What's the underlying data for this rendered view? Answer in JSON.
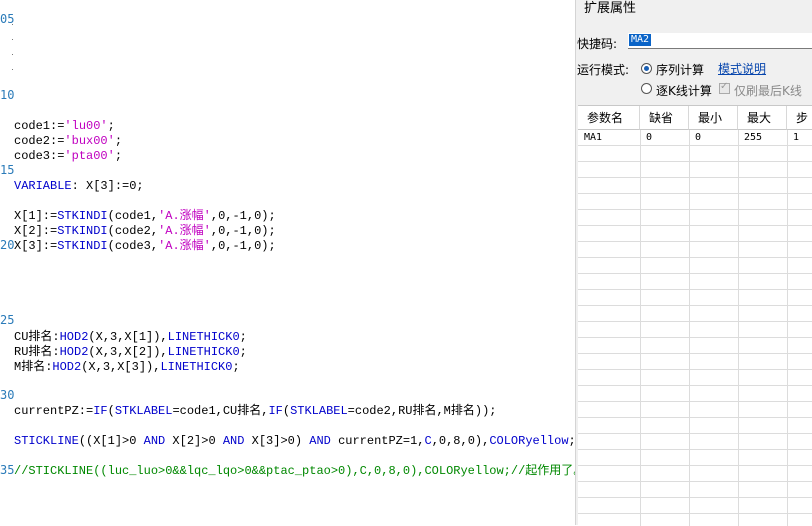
{
  "editor": {
    "line_numbers": [
      "05",
      "10",
      "15",
      "20",
      "25",
      "30",
      "35"
    ],
    "lines": {
      "code1": [
        {
          "t": "code1:=",
          "c": ""
        },
        {
          "t": "'lu00'",
          "c": "st"
        },
        {
          "t": ";",
          "c": ""
        }
      ],
      "code2": [
        {
          "t": "code2:=",
          "c": ""
        },
        {
          "t": "'bux00'",
          "c": "st"
        },
        {
          "t": ";",
          "c": ""
        }
      ],
      "code3": [
        {
          "t": "code3:=",
          "c": ""
        },
        {
          "t": "'pta00'",
          "c": "st"
        },
        {
          "t": ";",
          "c": ""
        }
      ],
      "variable": [
        {
          "t": "VARIABLE",
          "c": "kw"
        },
        {
          "t": ": X[3]:=0;",
          "c": ""
        }
      ],
      "x1": [
        {
          "t": "X[1]:=",
          "c": ""
        },
        {
          "t": "STKINDI",
          "c": "fn"
        },
        {
          "t": "(code1,",
          "c": ""
        },
        {
          "t": "'A.涨幅'",
          "c": "st"
        },
        {
          "t": ",0,-1,0);",
          "c": ""
        }
      ],
      "x2": [
        {
          "t": "X[2]:=",
          "c": ""
        },
        {
          "t": "STKINDI",
          "c": "fn"
        },
        {
          "t": "(code2,",
          "c": ""
        },
        {
          "t": "'A.涨幅'",
          "c": "st"
        },
        {
          "t": ",0,-1,0);",
          "c": ""
        }
      ],
      "x3": [
        {
          "t": "X[3]:=",
          "c": ""
        },
        {
          "t": "STKINDI",
          "c": "fn"
        },
        {
          "t": "(code3,",
          "c": ""
        },
        {
          "t": "'A.涨幅'",
          "c": "st"
        },
        {
          "t": ",0,-1,0);",
          "c": ""
        }
      ],
      "cu": [
        {
          "t": "CU排名:",
          "c": ""
        },
        {
          "t": "HOD2",
          "c": "fn"
        },
        {
          "t": "(X,3,X[1]),",
          "c": ""
        },
        {
          "t": "LINETHICK0",
          "c": "fn"
        },
        {
          "t": ";",
          "c": ""
        }
      ],
      "ru": [
        {
          "t": "RU排名:",
          "c": ""
        },
        {
          "t": "HOD2",
          "c": "fn"
        },
        {
          "t": "(X,3,X[2]),",
          "c": ""
        },
        {
          "t": "LINETHICK0",
          "c": "fn"
        },
        {
          "t": ";",
          "c": ""
        }
      ],
      "m": [
        {
          "t": "M排名:",
          "c": ""
        },
        {
          "t": "HOD2",
          "c": "fn"
        },
        {
          "t": "(X,3,X[3]),",
          "c": ""
        },
        {
          "t": "LINETHICK0",
          "c": "fn"
        },
        {
          "t": ";",
          "c": ""
        }
      ],
      "pz": [
        {
          "t": "currentPZ:=",
          "c": ""
        },
        {
          "t": "IF",
          "c": "fn"
        },
        {
          "t": "(",
          "c": ""
        },
        {
          "t": "STKLABEL",
          "c": "fn"
        },
        {
          "t": "=code1,CU排名,",
          "c": ""
        },
        {
          "t": "IF",
          "c": "fn"
        },
        {
          "t": "(",
          "c": ""
        },
        {
          "t": "STKLABEL",
          "c": "fn"
        },
        {
          "t": "=code2,RU排名,M排名));",
          "c": ""
        }
      ],
      "stick": [
        {
          "t": "STICKLINE",
          "c": "fn"
        },
        {
          "t": "((X[1]>0 ",
          "c": ""
        },
        {
          "t": "AND",
          "c": "kw"
        },
        {
          "t": " X[2]>0 ",
          "c": ""
        },
        {
          "t": "AND",
          "c": "kw"
        },
        {
          "t": " X[3]>0) ",
          "c": ""
        },
        {
          "t": "AND",
          "c": "kw"
        },
        {
          "t": " currentPZ=1,",
          "c": ""
        },
        {
          "t": "C",
          "c": "fn"
        },
        {
          "t": ",0,8,0),",
          "c": ""
        },
        {
          "t": "COLORyellow",
          "c": "fn"
        },
        {
          "t": ";",
          "c": ""
        }
      ],
      "comment": [
        {
          "t": "//STICKLINE((luc_luo>0&&lqc_lqo>0&&ptac_ptao>0),C,0,8,0),COLORyellow;//起作用了。",
          "c": "cm"
        }
      ]
    }
  },
  "panel": {
    "title": "扩展属性",
    "shortcut_label": "快捷码:",
    "shortcut_value": "MA2",
    "run_mode_label": "运行模式:",
    "mode_sequence": "序列计算",
    "mode_help": "模式说明",
    "mode_tick": "逐K线计算",
    "refresh_last": "仅刷最后K线",
    "grid": {
      "headers": [
        "参数名",
        "缺省",
        "最小",
        "最大",
        "步"
      ],
      "rows": [
        [
          "MA1",
          "0",
          "0",
          "255",
          "1"
        ]
      ]
    }
  }
}
